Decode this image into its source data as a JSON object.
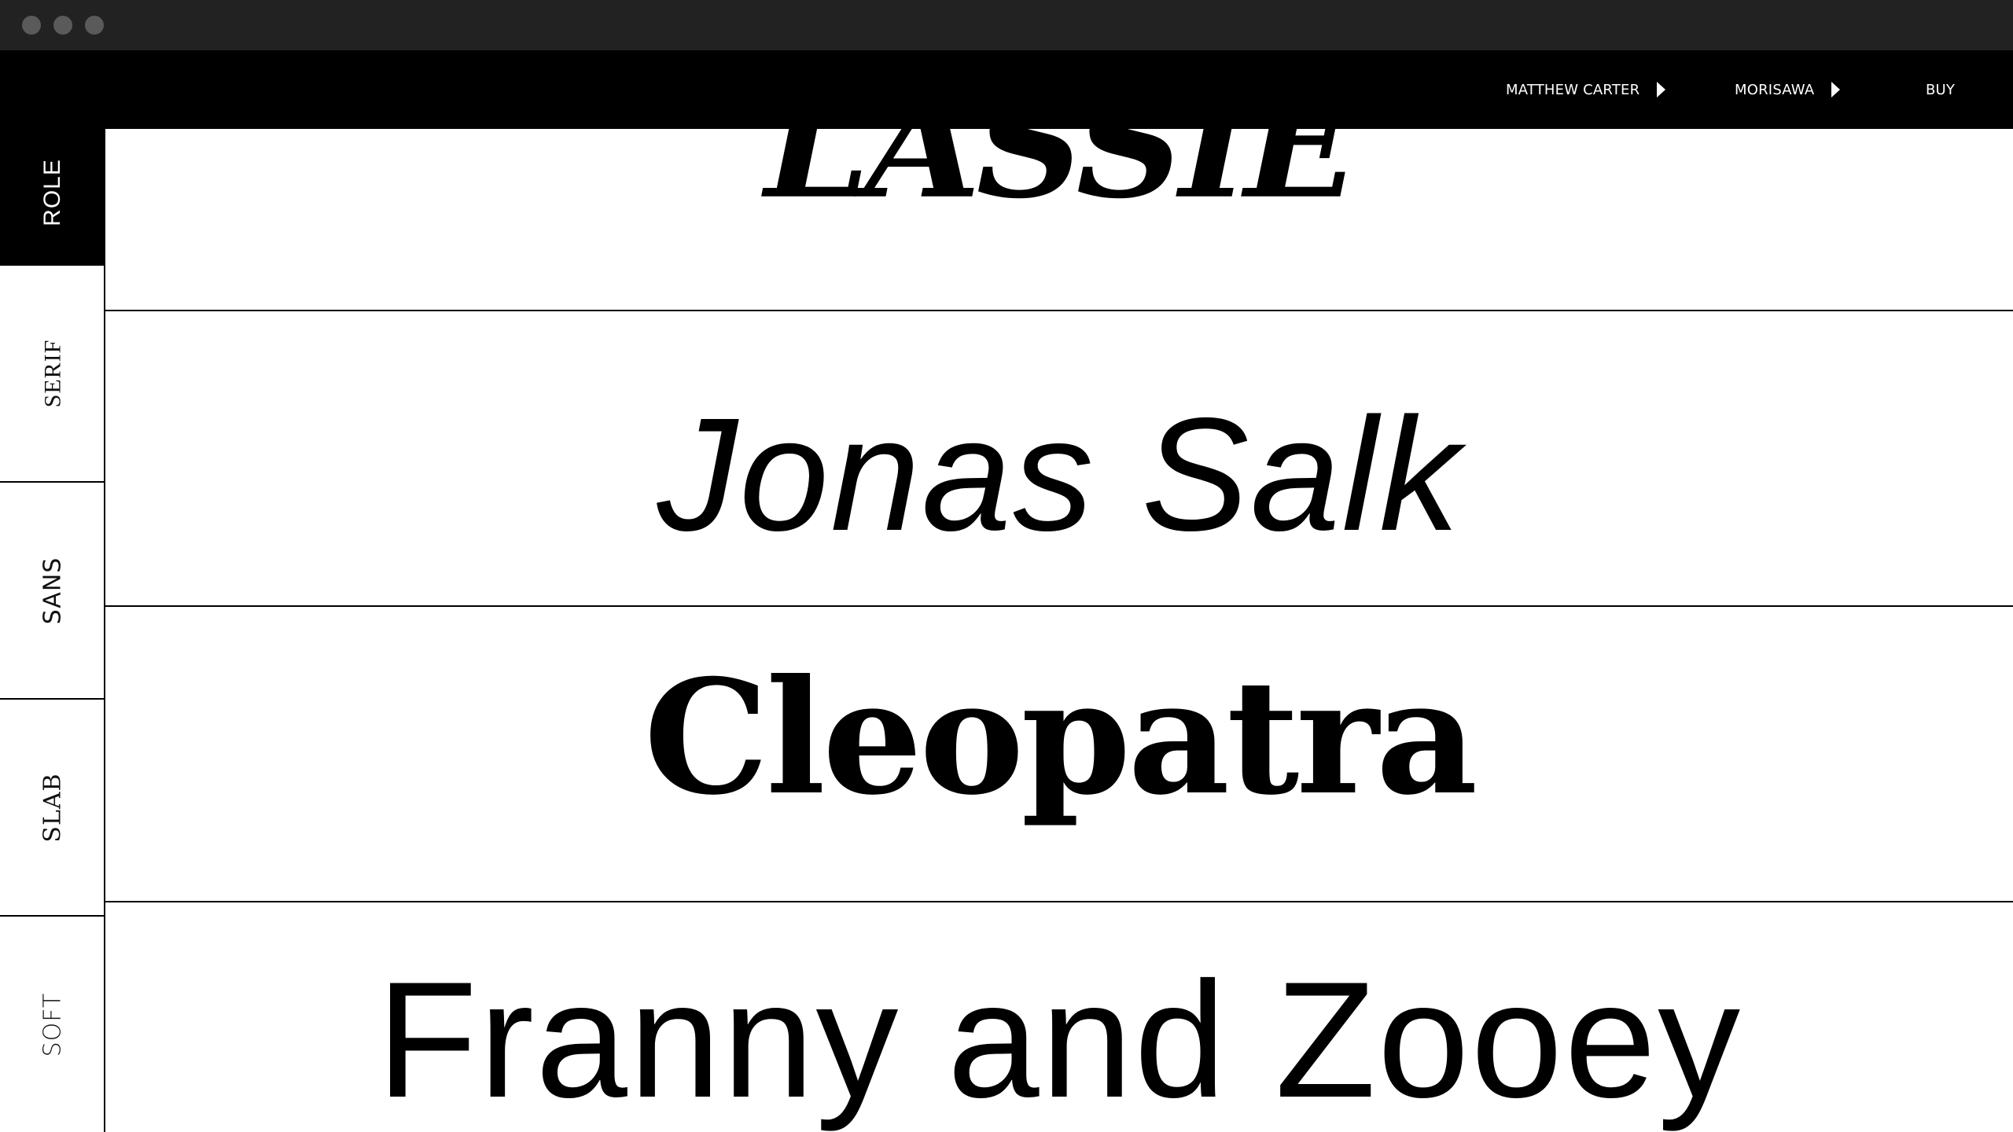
{
  "nav": {
    "designer_label": "MATTHEW CARTER",
    "foundry_label": "MORISAWA",
    "buy_label": "BUY"
  },
  "sidebar": {
    "tabs": [
      {
        "label": "ROLE",
        "active": true
      },
      {
        "label": "SERIF",
        "active": false
      },
      {
        "label": "SANS",
        "active": false
      },
      {
        "label": "SLAB",
        "active": false
      },
      {
        "label": "SOFT",
        "active": false
      }
    ]
  },
  "specimens": [
    {
      "text": "LASSIE"
    },
    {
      "text": "Jonas Salk"
    },
    {
      "text": "Cleopatra"
    },
    {
      "text": "Franny and Zooey"
    }
  ],
  "colors": {
    "chrome": "#222222",
    "nav_background": "#000000",
    "text": "#000000",
    "page_background": "#ffffff"
  }
}
